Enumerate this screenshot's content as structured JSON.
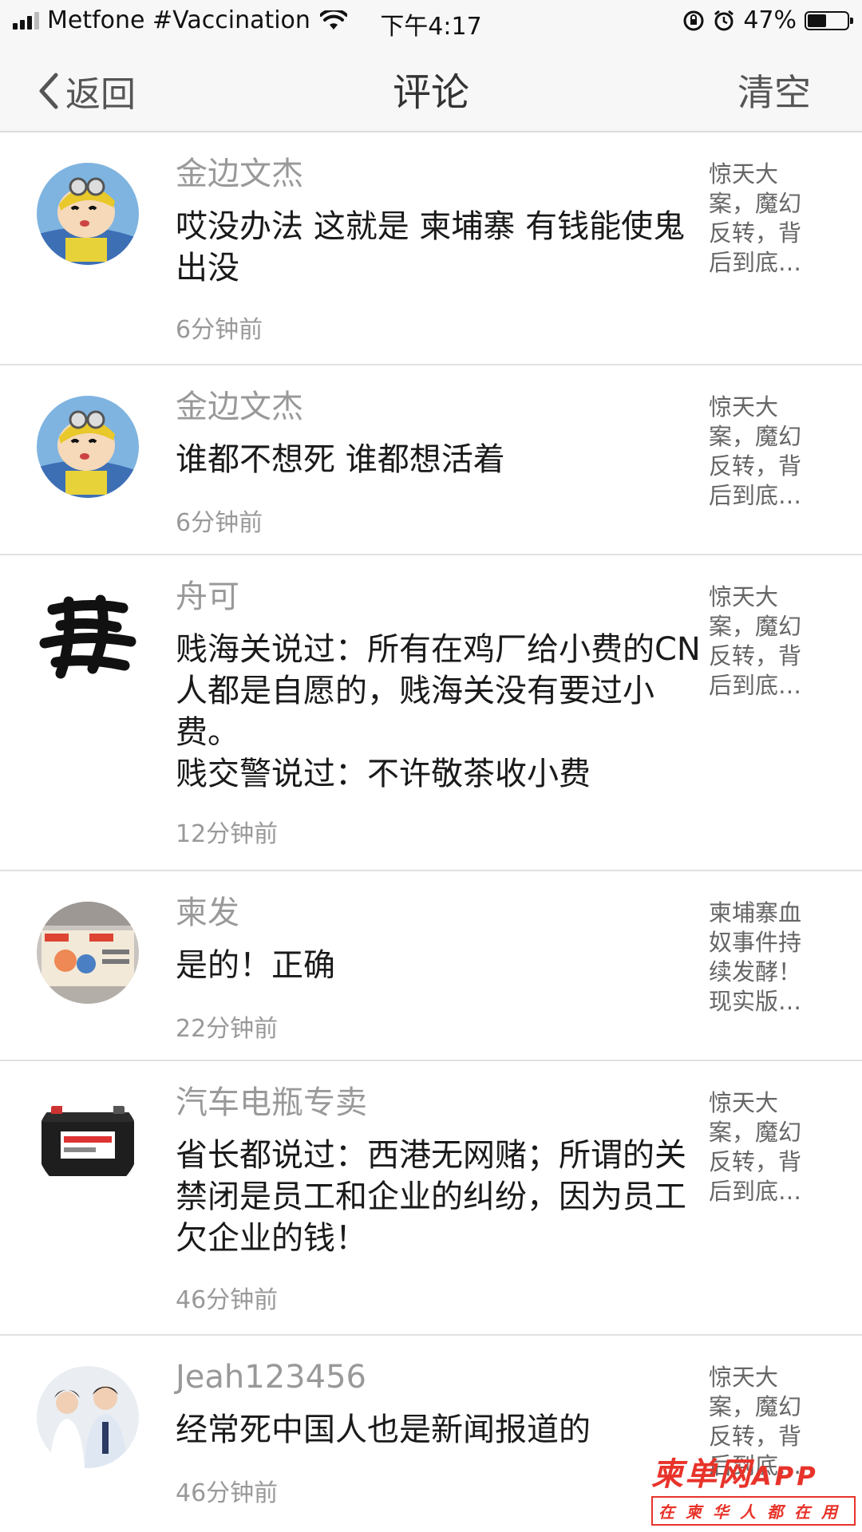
{
  "status_bar": {
    "carrier": "Metfone #Vaccination",
    "time": "下午4:17",
    "battery": "47%",
    "battery_level": 0.47
  },
  "nav": {
    "back_label": "返回",
    "title": "评论",
    "clear_label": "清空"
  },
  "comments": [
    {
      "user": "金边文杰",
      "text": "哎没办法 这就是 柬埔寨 有钱能使鬼出没",
      "time": "6分钟前",
      "article": "惊天大案，魔幻反转，背后到底…",
      "avatar": "cartoon-boy-avatar"
    },
    {
      "user": "金边文杰",
      "text": "谁都不想死 谁都想活着",
      "time": "6分钟前",
      "article": "惊天大案，魔幻反转，背后到底…",
      "avatar": "cartoon-boy-avatar"
    },
    {
      "user": "舟可",
      "text": "贱海关说过：所有在鸡厂给小费的CN人都是自愿的，贱海关没有要过小费。\n贱交警说过：不许敬茶收小费",
      "time": "12分钟前",
      "article": "惊天大案，魔幻反转，背后到底…",
      "avatar": "calligraphy-avatar"
    },
    {
      "user": "柬发",
      "text": "是的！正确",
      "time": "22分钟前",
      "article": "柬埔寨血奴事件持续发酵！现实版…",
      "avatar": "poster-avatar"
    },
    {
      "user": "汽车电瓶专卖",
      "text": "省长都说过：西港无网赌；所谓的关禁闭是员工和企业的纠纷，因为员工欠企业的钱！",
      "time": "46分钟前",
      "article": "惊天大案，魔幻反转，背后到底…",
      "avatar": "car-battery-avatar"
    },
    {
      "user": "Jeah123456",
      "text": "经常死中国人也是新闻报道的",
      "time": "46分钟前",
      "article": "惊天大案，魔幻反转，背后到底…",
      "avatar": "people-photo-avatar"
    }
  ],
  "watermark": {
    "main": "柬单网",
    "app": "APP",
    "sub": "在柬华人都在用"
  }
}
